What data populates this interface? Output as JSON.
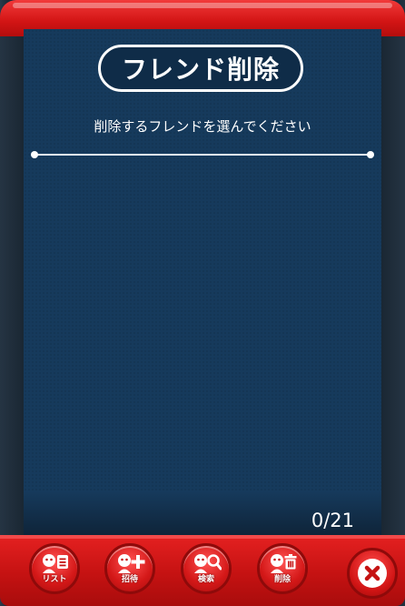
{
  "dialog": {
    "title": "フレンド削除",
    "subtitle": "削除するフレンドを選んでください",
    "counter": "0/21"
  },
  "bottom_nav": [
    {
      "label": "リスト",
      "icon": "friend-list-icon"
    },
    {
      "label": "招待",
      "icon": "friend-invite-icon"
    },
    {
      "label": "検索",
      "icon": "friend-search-icon"
    },
    {
      "label": "削除",
      "icon": "friend-delete-icon"
    }
  ],
  "close": {
    "icon": "close-icon"
  },
  "colors": {
    "frame_red": "#d21414",
    "panel_navy": "#163a5c",
    "text_white": "#ffffff"
  }
}
